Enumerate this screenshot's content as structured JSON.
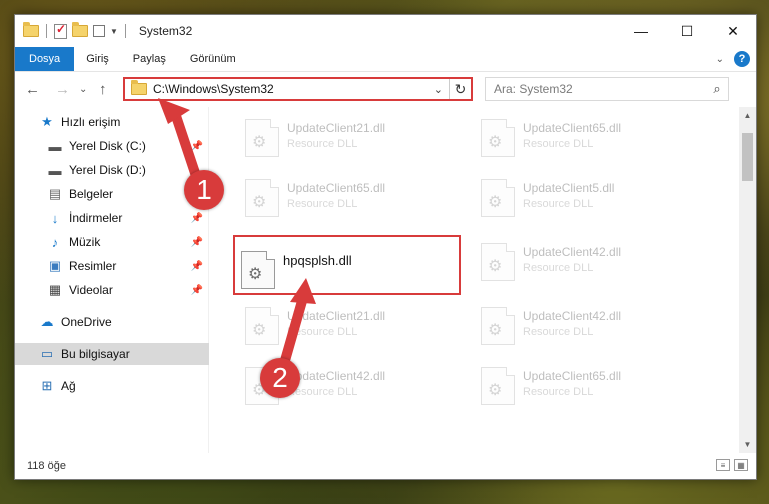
{
  "window": {
    "title": "System32",
    "controls": {
      "minimize": "—",
      "maximize": "☐",
      "close": "✕"
    }
  },
  "ribbon": {
    "tabs": [
      {
        "label": "Dosya"
      },
      {
        "label": "Giriş"
      },
      {
        "label": "Paylaş"
      },
      {
        "label": "Görünüm"
      }
    ],
    "help": "?"
  },
  "nav": {
    "back": "←",
    "forward": "→",
    "dropdown": "⌄",
    "up": "↑",
    "address": "C:\\Windows\\System32",
    "refresh": "↻",
    "search_placeholder": "Ara: System32"
  },
  "sidebar": {
    "items": [
      {
        "label": "Hızlı erişim",
        "icon": "star-icon"
      },
      {
        "label": "Yerel Disk (C:)",
        "icon": "drive-icon",
        "pinned": true
      },
      {
        "label": "Yerel Disk (D:)",
        "icon": "drive-icon"
      },
      {
        "label": "Belgeler",
        "icon": "documents-icon",
        "pinned": true
      },
      {
        "label": "İndirmeler",
        "icon": "download-icon",
        "pinned": true
      },
      {
        "label": "Müzik",
        "icon": "music-icon",
        "pinned": true
      },
      {
        "label": "Resimler",
        "icon": "pictures-icon",
        "pinned": true
      },
      {
        "label": "Videolar",
        "icon": "videos-icon",
        "pinned": true
      },
      {
        "label": "OneDrive",
        "icon": "cloud-icon"
      },
      {
        "label": "Bu bilgisayar",
        "icon": "computer-icon",
        "selected": true
      },
      {
        "label": "Ağ",
        "icon": "network-icon"
      }
    ]
  },
  "files": {
    "left_column": [
      {
        "name": "UpdateClient21.dll",
        "type": "Resource DLL"
      },
      {
        "name": "UpdateClient65.dll",
        "type": "Resource DLL"
      },
      {
        "name": "hpqsplsh.dll",
        "type": ""
      },
      {
        "name": "UpdateClient21.dll",
        "type": "Resource DLL"
      },
      {
        "name": "UpdateClient42.dll",
        "type": "Resource DLL"
      }
    ],
    "right_column": [
      {
        "name": "UpdateClient65.dll",
        "type": "Resource DLL"
      },
      {
        "name": "UpdateClient5.dll",
        "type": "Resource DLL"
      },
      {
        "name": "UpdateClient42.dll",
        "type": "Resource DLL"
      },
      {
        "name": "UpdateClient42.dll",
        "type": "Resource DLL"
      },
      {
        "name": "UpdateClient65.dll",
        "type": "Resource DLL"
      }
    ]
  },
  "status": {
    "item_count": "118 öğe"
  },
  "annotations": {
    "badge1": "1",
    "badge2": "2",
    "color": "#d83b3b"
  },
  "colors": {
    "accent": "#1979ca",
    "annotation": "#d83b3b"
  }
}
